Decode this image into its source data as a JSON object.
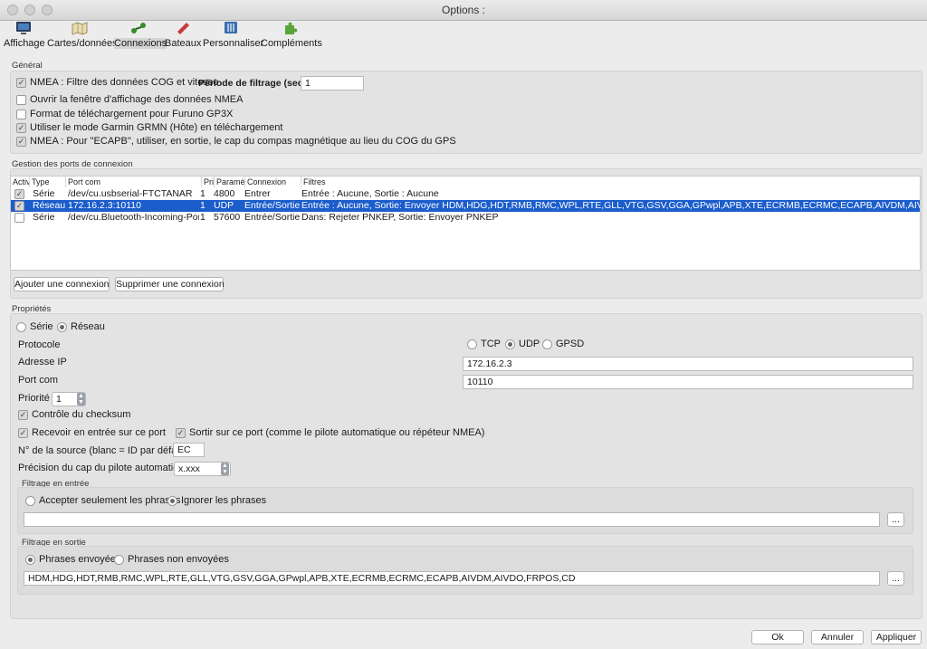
{
  "window": {
    "title": "Options :"
  },
  "toolbar": [
    {
      "label": "Affichage",
      "icon": "display-icon"
    },
    {
      "label": "Cartes/données",
      "icon": "charts-icon"
    },
    {
      "label": "Connexions",
      "icon": "connections-icon"
    },
    {
      "label": "Bateaux",
      "icon": "ships-icon"
    },
    {
      "label": "Personnaliser",
      "icon": "customize-icon"
    },
    {
      "label": "Compléments",
      "icon": "plugins-icon"
    }
  ],
  "general": {
    "label": "Général",
    "nmea_filter_label": "NMEA : Filtre des données COG et vitesse",
    "filter_period_label": "Période de filtrage (sec.)",
    "filter_period_value": "1",
    "open_nmea_window_label": "Ouvrir la fenêtre d'affichage des données NMEA",
    "furuno_label": "Format de téléchargement pour Furuno GP3X",
    "garmin_label": "Utiliser le mode Garmin GRMN (Hôte) en téléchargement",
    "ecapb_label": "NMEA : Pour \"ECAPB\", utiliser, en sortie, le cap du compas magnétique  au lieu du COG du GPS"
  },
  "ports": {
    "label": "Gestion des ports de connexion",
    "columns": [
      "Activ",
      "Type",
      "Port com",
      "Pri",
      "Paramètr",
      "Connexion",
      "Filtres"
    ],
    "rows": [
      {
        "type": "Série",
        "port": "/dev/cu.usbserial-FTCTANAR",
        "pri": "1",
        "param": "4800",
        "conn": "Entrer",
        "filters": "Entrée : Aucune, Sortie : Aucune"
      },
      {
        "type": "Réseau",
        "port": "172.16.2.3:10110",
        "pri": "1",
        "param": "UDP",
        "conn": "Entrée/Sortie",
        "filters": "Entrée : Aucune, Sortie: Envoyer HDM,HDG,HDT,RMB,RMC,WPL,RTE,GLL,VTG,GSV,GGA,GPwpl,APB,XTE,ECRMB,ECRMC,ECAPB,AIVDM,AIVDO,FRPOS,CD"
      },
      {
        "type": "Série",
        "port": "/dev/cu.Bluetooth-Incoming-Port",
        "pri": "1",
        "param": "57600",
        "conn": "Entrée/Sortie",
        "filters": "Dans: Rejeter PNKEP, Sortie: Envoyer PNKEP"
      }
    ],
    "add_button": "Ajouter une connexion",
    "remove_button": "Supprimer une connexion"
  },
  "props": {
    "label": "Propriétés",
    "serie_label": "Série",
    "reseau_label": "Réseau",
    "protocol_label": "Protocole",
    "tcp_label": "TCP",
    "udp_label": "UDP",
    "gpsd_label": "GPSD",
    "ip_label": "Adresse IP",
    "ip_value": "172.16.2.3",
    "port_label": "Port com",
    "port_value": "10110",
    "priority_label": "Priorité",
    "priority_value": "1",
    "checksum_label": "Contrôle du checksum",
    "receive_label": "Recevoir en entrée sur ce port",
    "output_label": "Sortir sur ce port (comme le pilote automatique ou répéteur NMEA)",
    "source_label": "N° de la source (blanc = ID par défaut)",
    "source_value": "EC",
    "precision_label": "Précision du cap du pilote automatique",
    "precision_value": "x.xxx"
  },
  "input_filter": {
    "label": "Filtrage en entrée",
    "accept_label": "Accepter seulement les phrases",
    "ignore_label": "Ignorer les phrases",
    "value": "",
    "browse": "..."
  },
  "output_filter": {
    "label": "Filtrage en sortie",
    "sent_label": "Phrases envoyées",
    "not_sent_label": "Phrases non envoyées",
    "value": "HDM,HDG,HDT,RMB,RMC,WPL,RTE,GLL,VTG,GSV,GGA,GPwpl,APB,XTE,ECRMB,ECRMC,ECAPB,AIVDM,AIVDO,FRPOS,CD",
    "browse": "..."
  },
  "footer": {
    "ok": "Ok",
    "cancel": "Annuler",
    "apply": "Appliquer"
  }
}
